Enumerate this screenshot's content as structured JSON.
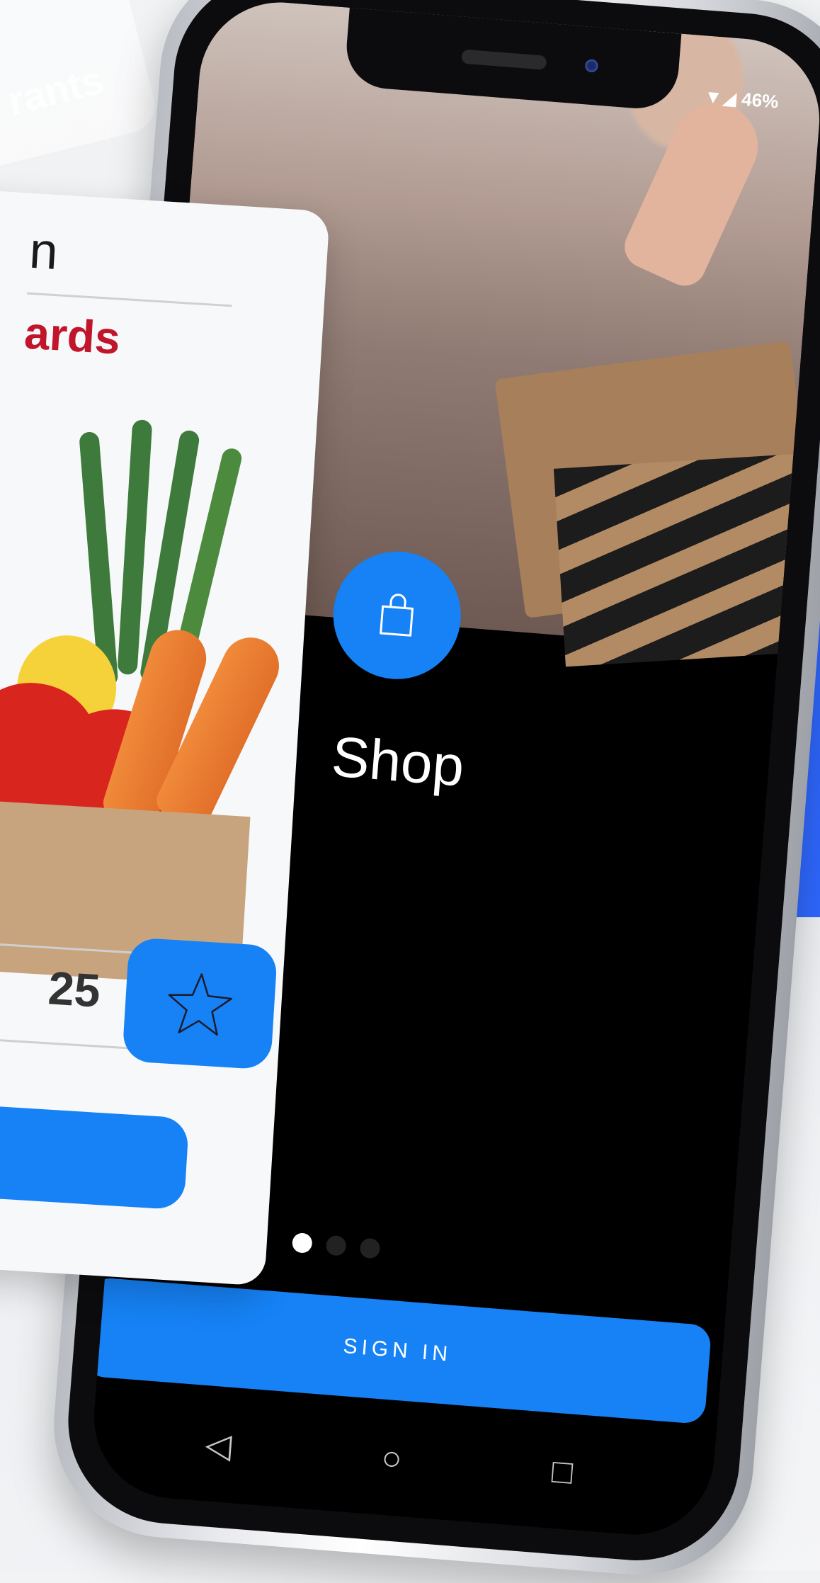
{
  "background": {
    "card_text": "rants",
    "accent_block_color": "#2f68ff"
  },
  "phone": {
    "status_bar": {
      "battery": "46%",
      "icons": [
        "wifi-icon",
        "signal-icon"
      ]
    },
    "hero": {
      "title": "Shop",
      "icon": "shopping-bag-icon",
      "accent_color": "#1682f5"
    },
    "pagination": {
      "active_page": 1,
      "total_pages": 3
    },
    "signin_button": {
      "label": "SIGN IN"
    },
    "nav_bar": {
      "back_icon": "◁",
      "home_icon": "○",
      "recent_icon": "□"
    }
  },
  "card": {
    "title_fragment": "n",
    "rewards_fragment": "ards",
    "points_fragment": "25",
    "star_icon": "star-icon"
  }
}
